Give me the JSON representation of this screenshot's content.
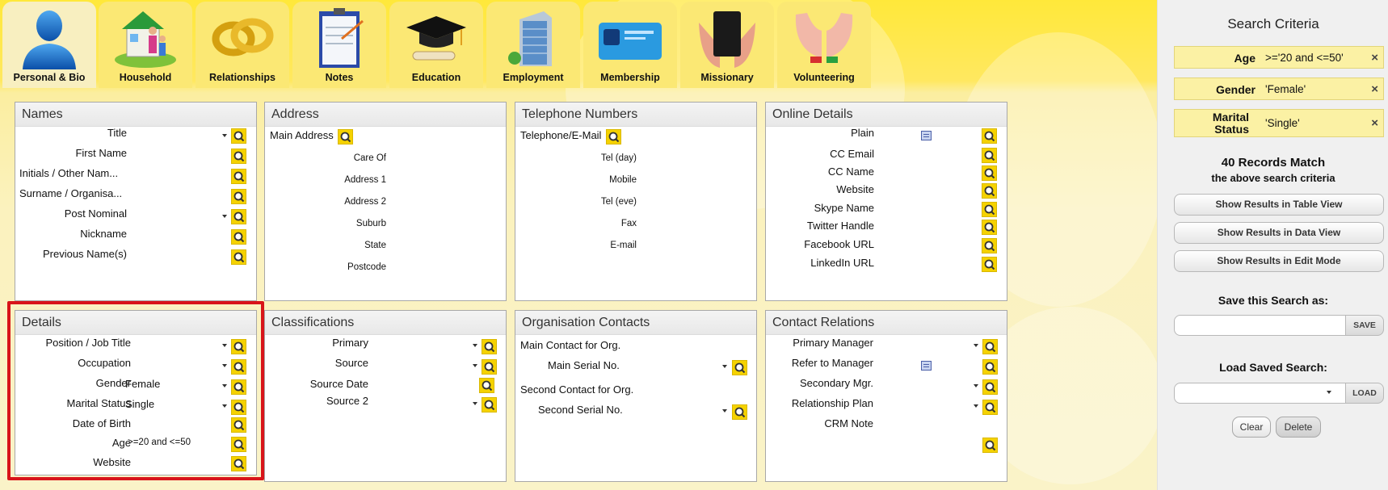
{
  "tabs": [
    {
      "label": "Personal & Bio",
      "icon": "person-icon"
    },
    {
      "label": "Household",
      "icon": "household-icon"
    },
    {
      "label": "Relationships",
      "icon": "rings-icon"
    },
    {
      "label": "Notes",
      "icon": "notepad-icon"
    },
    {
      "label": "Education",
      "icon": "graduation-cap-icon"
    },
    {
      "label": "Employment",
      "icon": "office-building-icon"
    },
    {
      "label": "Membership",
      "icon": "membership-card-icon"
    },
    {
      "label": "Missionary",
      "icon": "hands-bible-icon"
    },
    {
      "label": "Volunteering",
      "icon": "open-hands-icon"
    }
  ],
  "panels": {
    "names": {
      "title": "Names",
      "fields": [
        "Title",
        "First Name",
        "Initials / Other Nam...",
        "Surname / Organisa...",
        "Post Nominal",
        "Nickname",
        "Previous Name(s)"
      ]
    },
    "address": {
      "title": "Address",
      "main_label": "Main Address",
      "fields": [
        "Care Of",
        "Address 1",
        "Address 2",
        "Suburb",
        "State",
        "Postcode"
      ]
    },
    "telephone": {
      "title": "Telephone Numbers",
      "main_label": "Telephone/E-Mail",
      "fields": [
        "Tel (day)",
        "Mobile",
        "Tel (eve)",
        "Fax",
        "E-mail"
      ]
    },
    "online": {
      "title": "Online Details",
      "fields": [
        "Plain",
        "CC Email",
        "CC Name",
        "Website",
        "Skype Name",
        "Twitter Handle",
        "Facebook URL",
        "LinkedIn URL"
      ]
    },
    "details": {
      "title": "Details",
      "fields": [
        {
          "label": "Position / Job Title",
          "value": ""
        },
        {
          "label": "Occupation",
          "value": ""
        },
        {
          "label": "Gender",
          "value": "Female"
        },
        {
          "label": "Marital Status",
          "value": "Single"
        },
        {
          "label": "Date of Birth",
          "value": ""
        },
        {
          "label": "Age",
          "value": ">=20 and <=50"
        },
        {
          "label": "Website",
          "value": ""
        }
      ]
    },
    "classifications": {
      "title": "Classifications",
      "fields": [
        "Primary",
        "Source",
        "Source Date",
        "Source 2"
      ]
    },
    "org_contacts": {
      "title": "Organisation Contacts",
      "main_contact": "Main Contact for Org.",
      "main_serial": "Main Serial No.",
      "second_contact": "Second Contact for Org.",
      "second_serial": "Second Serial No."
    },
    "contact_relations": {
      "title": "Contact Relations",
      "fields": [
        "Primary Manager",
        "Refer to Manager",
        "Secondary Mgr.",
        "Relationship Plan",
        "CRM Note"
      ]
    }
  },
  "sidebar": {
    "title": "Search Criteria",
    "criteria": [
      {
        "label": "Age",
        "value": ">='20 and <=50'"
      },
      {
        "label": "Gender",
        "value": "'Female'"
      },
      {
        "label": "Marital Status",
        "value": "'Single'"
      }
    ],
    "remove_glyph": "×",
    "match_count": "40 Records Match",
    "match_sub": "the above search criteria",
    "buttons": {
      "table_view": "Show Results in Table View",
      "data_view": "Show Results in Data View",
      "edit_mode": "Show Results in Edit Mode"
    },
    "save_label": "Save this Search as:",
    "save_input_value": "",
    "save_button": "SAVE",
    "load_label": "Load Saved Search:",
    "load_selected": "",
    "load_button": "LOAD",
    "clear_button": "Clear",
    "delete_button": "Delete"
  },
  "colors": {
    "tab_bg": "#fbe874",
    "active_tab_bg": "#f8efc0",
    "search_icon": "#f5d200",
    "criteria_bg": "#fbf1a4",
    "highlight": "#d8141a"
  }
}
